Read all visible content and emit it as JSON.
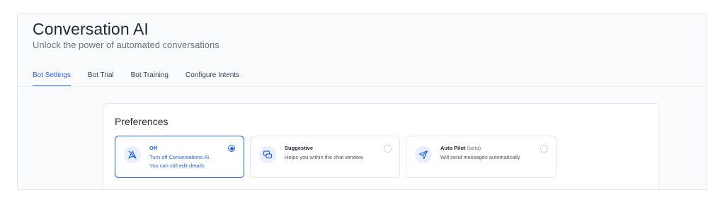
{
  "header": {
    "title": "Conversation AI",
    "subtitle": "Unlock the power of automated conversations"
  },
  "tabs": [
    {
      "label": "Bot Settings",
      "active": true
    },
    {
      "label": "Bot Trial",
      "active": false
    },
    {
      "label": "Bot Training",
      "active": false
    },
    {
      "label": "Configure Intents",
      "active": false
    }
  ],
  "preferences": {
    "title": "Preferences",
    "options": [
      {
        "name": "Off",
        "badge": "",
        "desc_line1": "Turn off Conversations AI.",
        "desc_line2": "You can still edit details",
        "icon": "send-off-icon",
        "selected": true
      },
      {
        "name": "Suggestive",
        "badge": "",
        "desc_line1": "Helps you within the chat window.",
        "desc_line2": "",
        "icon": "chat-bubbles-icon",
        "selected": false
      },
      {
        "name": "Auto Pilot",
        "badge": "(beta)",
        "desc_line1": "Will send messages automatically",
        "desc_line2": "",
        "icon": "send-icon",
        "selected": false
      }
    ]
  },
  "colors": {
    "accent": "#2563eb",
    "icon_bg": "#e8eefc"
  }
}
